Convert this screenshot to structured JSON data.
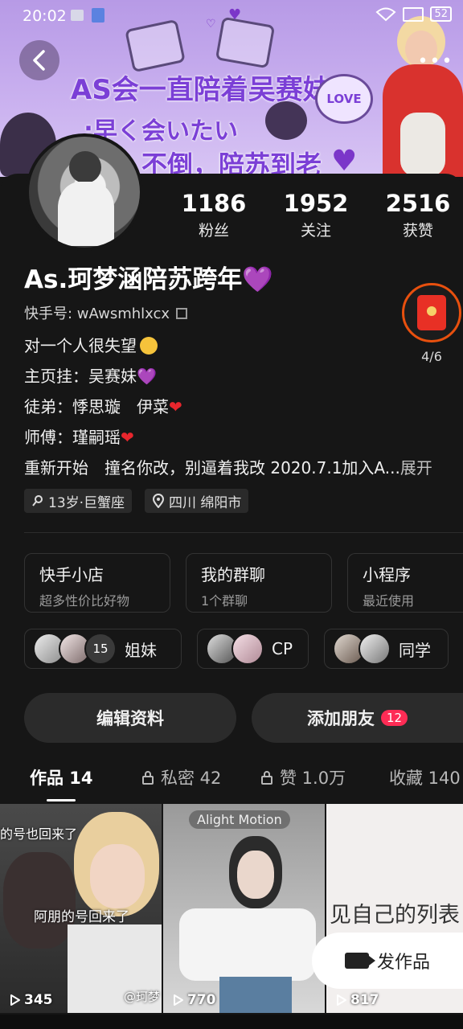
{
  "status": {
    "time": "20:02",
    "battery": "52"
  },
  "banner": {
    "line1": "AS会一直陪着吴赛妹",
    "line2": ":早く会いたい",
    "line3": "不倒，陪苏到老",
    "love_sign": "LOVE"
  },
  "stats": [
    {
      "num": "1186",
      "label": "粉丝"
    },
    {
      "num": "1952",
      "label": "关注"
    },
    {
      "num": "2516",
      "label": "获赞"
    }
  ],
  "profile": {
    "name": "As.珂梦涵陪苏跨年",
    "name_heart": "💜",
    "uid": "快手号: wAwsmhlxcx",
    "bio1": "对一个人很失望",
    "bio2": "主页挂：吴赛妹",
    "bio2_heart": "💜",
    "bio3": "徒弟：悸思璇　伊菜",
    "bio4": "师傅：瑾嗣瑶",
    "heart": "❤",
    "bio5": "重新开始　撞名你改，别逼着我改 2020.7.1加入A...",
    "expand": "展开",
    "tag_age": "13岁·巨蟹座",
    "tag_location": "四川 绵阳市"
  },
  "redpack": {
    "count": "4/6"
  },
  "services": [
    {
      "title": "快手小店",
      "sub": "超多性价比好物"
    },
    {
      "title": "我的群聊",
      "sub": "1个群聊"
    },
    {
      "title": "小程序",
      "sub": "最近使用"
    }
  ],
  "groups": [
    {
      "label": "姐妹",
      "count": "15"
    },
    {
      "label": "CP"
    },
    {
      "label": "同学"
    }
  ],
  "buttons": {
    "edit": "编辑资料",
    "add_friend": "添加朋友",
    "add_friend_badge": "12"
  },
  "tabs": [
    {
      "label": "作品 14"
    },
    {
      "label": "私密 42"
    },
    {
      "label": "赞 1.0万"
    },
    {
      "label": "收藏 140"
    }
  ],
  "videos": [
    {
      "views": "345",
      "caption_top": "的号也回来了",
      "caption_mid": "阿朋的号回来了",
      "watermark": "@珂梦"
    },
    {
      "views": "770",
      "caption_top": "Alight Motion"
    },
    {
      "views": "817",
      "caption_mid": "见自己的列表"
    }
  ],
  "fab": {
    "label": "发作品"
  }
}
